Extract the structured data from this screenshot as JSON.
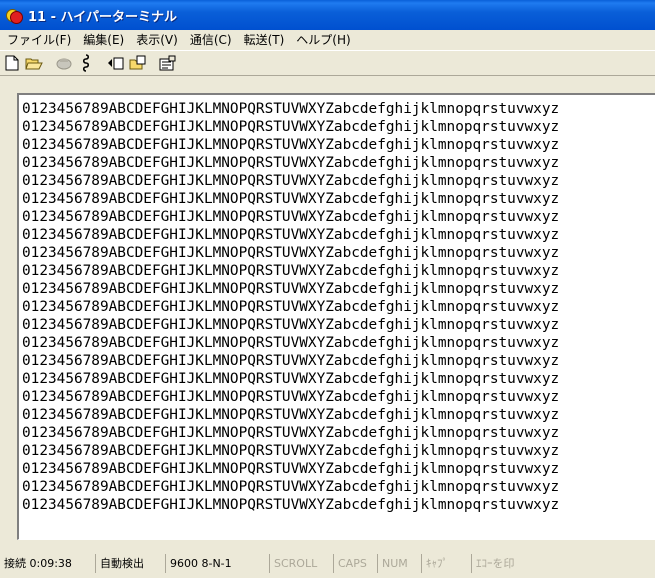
{
  "window": {
    "title": "11 - ハイパーターミナル",
    "icon": "hyperterminal-app-icon"
  },
  "menu": [
    "ファイル(F)",
    "編集(E)",
    "表示(V)",
    "通信(C)",
    "転送(T)",
    "ヘルプ(H)"
  ],
  "toolbar": {
    "buttons": [
      "new-document-icon",
      "open-folder-icon",
      "phone-call-icon",
      "disconnect-icon",
      "send-icon",
      "receive-icon",
      "properties-icon"
    ]
  },
  "terminal": {
    "lines": [
      "0123456789ABCDEFGHIJKLMNOPQRSTUVWXYZabcdefghijklmnopqrstuvwxyz",
      "0123456789ABCDEFGHIJKLMNOPQRSTUVWXYZabcdefghijklmnopqrstuvwxyz",
      "0123456789ABCDEFGHIJKLMNOPQRSTUVWXYZabcdefghijklmnopqrstuvwxyz",
      "0123456789ABCDEFGHIJKLMNOPQRSTUVWXYZabcdefghijklmnopqrstuvwxyz",
      "0123456789ABCDEFGHIJKLMNOPQRSTUVWXYZabcdefghijklmnopqrstuvwxyz",
      "0123456789ABCDEFGHIJKLMNOPQRSTUVWXYZabcdefghijklmnopqrstuvwxyz",
      "0123456789ABCDEFGHIJKLMNOPQRSTUVWXYZabcdefghijklmnopqrstuvwxyz",
      "0123456789ABCDEFGHIJKLMNOPQRSTUVWXYZabcdefghijklmnopqrstuvwxyz",
      "0123456789ABCDEFGHIJKLMNOPQRSTUVWXYZabcdefghijklmnopqrstuvwxyz",
      "0123456789ABCDEFGHIJKLMNOPQRSTUVWXYZabcdefghijklmnopqrstuvwxyz",
      "0123456789ABCDEFGHIJKLMNOPQRSTUVWXYZabcdefghijklmnopqrstuvwxyz",
      "0123456789ABCDEFGHIJKLMNOPQRSTUVWXYZabcdefghijklmnopqrstuvwxyz",
      "0123456789ABCDEFGHIJKLMNOPQRSTUVWXYZabcdefghijklmnopqrstuvwxyz",
      "0123456789ABCDEFGHIJKLMNOPQRSTUVWXYZabcdefghijklmnopqrstuvwxyz",
      "0123456789ABCDEFGHIJKLMNOPQRSTUVWXYZabcdefghijklmnopqrstuvwxyz",
      "0123456789ABCDEFGHIJKLMNOPQRSTUVWXYZabcdefghijklmnopqrstuvwxyz",
      "0123456789ABCDEFGHIJKLMNOPQRSTUVWXYZabcdefghijklmnopqrstuvwxyz",
      "0123456789ABCDEFGHIJKLMNOPQRSTUVWXYZabcdefghijklmnopqrstuvwxyz",
      "0123456789ABCDEFGHIJKLMNOPQRSTUVWXYZabcdefghijklmnopqrstuvwxyz",
      "0123456789ABCDEFGHIJKLMNOPQRSTUVWXYZabcdefghijklmnopqrstuvwxyz",
      "0123456789ABCDEFGHIJKLMNOPQRSTUVWXYZabcdefghijklmnopqrstuvwxyz",
      "0123456789ABCDEFGHIJKLMNOPQRSTUVWXYZabcdefghijklmnopqrstuvwxyz",
      "0123456789ABCDEFGHIJKLMNOPQRSTUVWXYZabcdefghijklmnopqrstuvwxyz"
    ]
  },
  "status": {
    "connected": "接続 0:09:38",
    "detect": "自動検出",
    "settings": "9600 8-N-1",
    "scroll": "SCROLL",
    "caps": "CAPS",
    "num": "NUM",
    "capture": "ｷｬﾌﾟ",
    "echo": "ｴｺｰを印"
  },
  "colors": {
    "titlebar": "#0a5fd8",
    "chrome": "#ece9d8",
    "terminal_bg": "#ffffff",
    "terminal_fg": "#000000"
  }
}
